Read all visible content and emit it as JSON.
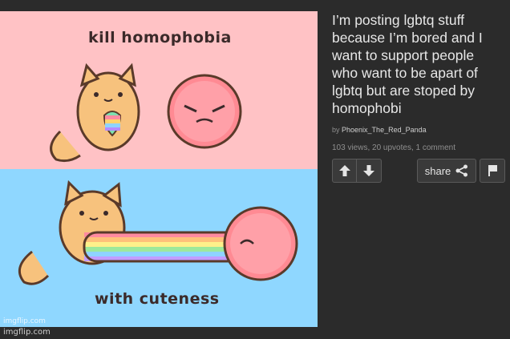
{
  "meme": {
    "caption_top": "kill homophobia",
    "caption_bottom": "with cuteness",
    "watermark": "imgflip.com",
    "colors": {
      "top_panel": "#ffc2c5",
      "bottom_panel": "#8fd7ff"
    }
  },
  "page_watermark": "imgflip.com",
  "post": {
    "title": "I’m posting lgbtq stuff because I’m bored and I want to support people who want to be apart of lgbtq but are stoped by homophobi",
    "by_prefix": "by",
    "author": "Phoenix_The_Red_Panda",
    "stats": "103 views, 20 upvotes, 1 comment"
  },
  "actions": {
    "upvote_icon": "arrow-up-icon",
    "downvote_icon": "arrow-down-icon",
    "share_label": "share",
    "share_icon": "share-icon",
    "flag_icon": "flag-icon"
  }
}
